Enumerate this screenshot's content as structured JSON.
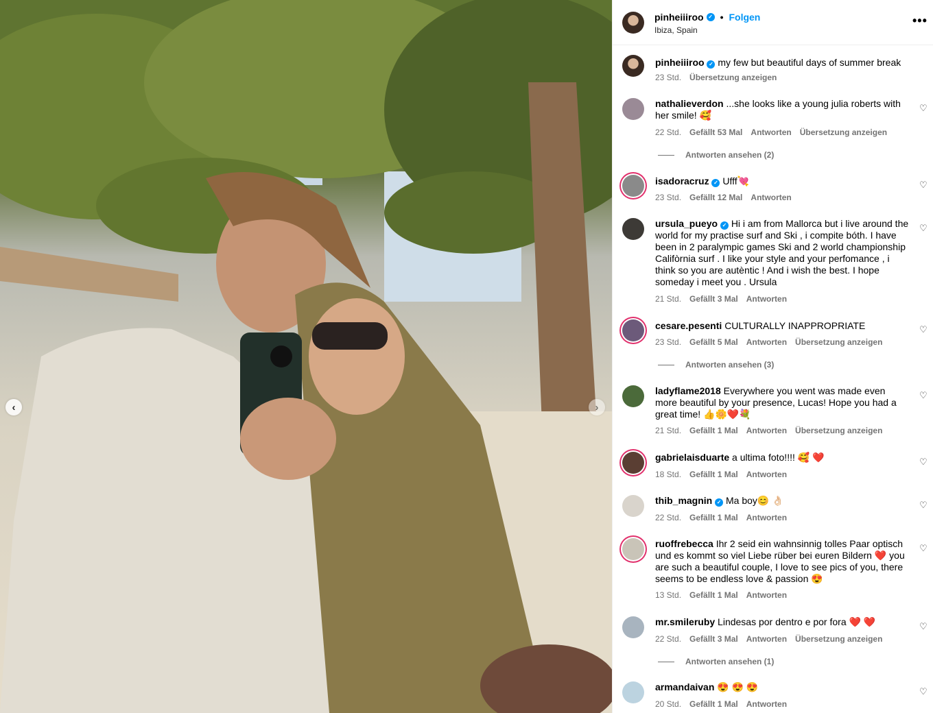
{
  "post": {
    "username": "pinheiiiroo",
    "follow_label": "Folgen",
    "location": "Ibiza, Spain",
    "more_label": "•••",
    "caption": "my few but beautiful days of summer break",
    "caption_time": "23 Std.",
    "translate_label": "Übersetzung anzeigen"
  },
  "labels": {
    "reply": "Antworten",
    "heart": "♡",
    "prev": "‹",
    "next": "›",
    "verified": "✓"
  },
  "comments": [
    {
      "user": "nathalieverdon",
      "text": "...she looks like a young julia roberts with her smile! 🥰",
      "time": "22 Std.",
      "likes": "Gefällt 53 Mal",
      "translate": "Übersetzung anzeigen",
      "replies": "Antworten ansehen (2)"
    },
    {
      "user": "isadoracruz",
      "verified": true,
      "text": "Ufff💘",
      "time": "23 Std.",
      "likes": "Gefällt 12 Mal"
    },
    {
      "user": "ursula_pueyo",
      "verified": true,
      "text": "Hi i am from Mallorca but i live around the world for my practise surf and Ski , i compite bóth. I have been in 2 paralympic games Ski and 2 world championship Califòrnia surf . I like your style and your perfomance , i think so you are autèntic ! And i wish the best. I hope someday i meet you . Ursula",
      "time": "21 Std.",
      "likes": "Gefällt 3 Mal"
    },
    {
      "user": "cesare.pesenti",
      "text": "CULTURALLY INAPPROPRIATE",
      "time": "23 Std.",
      "likes": "Gefällt 5 Mal",
      "translate": "Übersetzung anzeigen",
      "replies": "Antworten ansehen (3)"
    },
    {
      "user": "ladyflame2018",
      "text": "Everywhere you went was made even more beautiful by your presence, Lucas! Hope you had a great time! 👍🌼❤️💐",
      "time": "21 Std.",
      "likes": "Gefällt 1 Mal",
      "translate": "Übersetzung anzeigen"
    },
    {
      "user": "gabrielaisduarte",
      "text": "a ultima foto!!!! 🥰 ❤️",
      "time": "18 Std.",
      "likes": "Gefällt 1 Mal"
    },
    {
      "user": "thib_magnin",
      "verified": true,
      "text": "Ma boy😊 👌🏻",
      "time": "22 Std.",
      "likes": "Gefällt 1 Mal"
    },
    {
      "user": "ruoffrebecca",
      "text": "Ihr 2 seid ein wahnsinnig tolles Paar optisch und es kommt so viel Liebe rüber bei euren Bildern ❤️ you are such a beautiful couple, I love to see pics of you, there seems to be endless love & passion 😍",
      "time": "13 Std.",
      "likes": "Gefällt 1 Mal"
    },
    {
      "user": "mr.smileruby",
      "text": "Lindesas por dentro e por fora ❤️ ❤️",
      "time": "22 Std.",
      "likes": "Gefällt 3 Mal",
      "translate": "Übersetzung anzeigen",
      "replies": "Antworten ansehen (1)"
    },
    {
      "user": "armandaivan",
      "text": "😍 😍 😍",
      "time": "20 Std.",
      "likes": "Gefällt 1 Mal"
    }
  ],
  "colors": {
    "accent": "#0095f6",
    "meta": "#737373",
    "border": "#efefef",
    "story_ring": "#e1306c"
  },
  "icons": [
    "verified-badge-icon",
    "heart-icon",
    "more-icon",
    "chevron-left-icon",
    "chevron-right-icon"
  ]
}
